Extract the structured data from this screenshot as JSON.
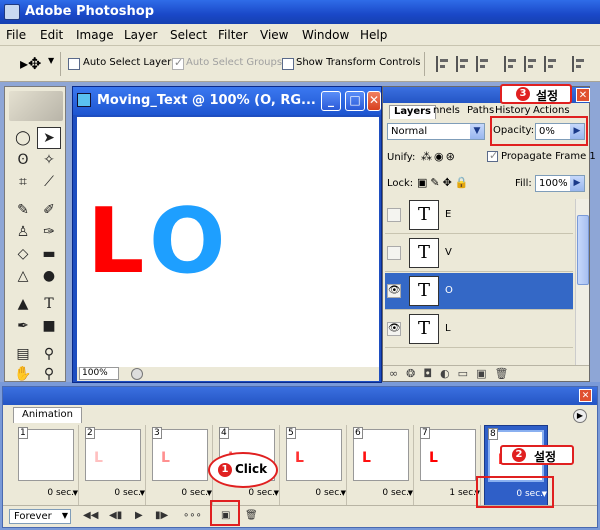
{
  "app": {
    "title": "Adobe Photoshop"
  },
  "menu": [
    "File",
    "Edit",
    "Image",
    "Layer",
    "Select",
    "Filter",
    "View",
    "Window",
    "Help"
  ],
  "options": {
    "auto_select_layer": "Auto Select Layer",
    "auto_select_groups": "Auto Select Groups",
    "show_transform": "Show Transform Controls"
  },
  "document": {
    "title": "Moving_Text @ 100% (O, RG...",
    "zoom": "100%",
    "letters": [
      {
        "char": "L",
        "color": "#ff0000"
      },
      {
        "char": "O",
        "color": "#1e9fff"
      }
    ]
  },
  "layers_panel": {
    "tabs": [
      "Layers",
      "nnels",
      "Paths",
      "History",
      "Actions"
    ],
    "blend_mode": "Normal",
    "opacity_label": "Opacity:",
    "opacity_value": "0%",
    "unify_label": "Unify:",
    "propagate_label": "Propagate Frame 1",
    "lock_label": "Lock:",
    "fill_label": "Fill:",
    "fill_value": "100%",
    "layers": [
      {
        "name": "E",
        "visible": false,
        "selected": false,
        "thumb": "T"
      },
      {
        "name": "V",
        "visible": false,
        "selected": false,
        "thumb": "T"
      },
      {
        "name": "O",
        "visible": true,
        "selected": true,
        "thumb": "T"
      },
      {
        "name": "L",
        "visible": true,
        "selected": false,
        "thumb": "T"
      }
    ]
  },
  "annotations": {
    "step1": {
      "num": "1",
      "text": "Click"
    },
    "step2": {
      "num": "2",
      "text": "설정"
    },
    "step3": {
      "num": "3",
      "text": "설정"
    }
  },
  "animation": {
    "tab": "Animation",
    "loop": "Forever",
    "frames": [
      {
        "num": "1",
        "delay": "0 sec.",
        "mark": "",
        "mark_color": "#ff0000"
      },
      {
        "num": "2",
        "delay": "0 sec.",
        "mark": "L",
        "mark_color": "#ffc0c0"
      },
      {
        "num": "3",
        "delay": "0 sec.",
        "mark": "L",
        "mark_color": "#ff9090"
      },
      {
        "num": "4",
        "delay": "0 sec.",
        "mark": "L",
        "mark_color": "#ff6060"
      },
      {
        "num": "5",
        "delay": "0 sec.",
        "mark": "L",
        "mark_color": "#ff3030"
      },
      {
        "num": "6",
        "delay": "0 sec.",
        "mark": "L",
        "mark_color": "#ff1010"
      },
      {
        "num": "7",
        "delay": "1 sec.",
        "mark": "L",
        "mark_color": "#ff0000"
      },
      {
        "num": "8",
        "delay": "0 sec.",
        "mark": "L",
        "mark_color": "#ff0000"
      }
    ]
  }
}
